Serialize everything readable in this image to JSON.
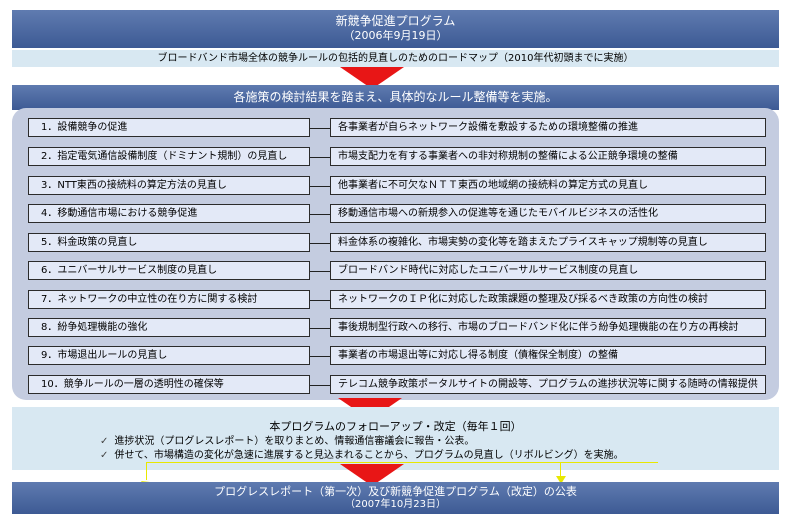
{
  "header": {
    "title": "新競争促進プログラム",
    "date": "（2006年9月19日）",
    "subtitle": "ブロードバンド市場全体の競争ルールの包括的見直しのためのロードマップ（2010年代初頭までに実施）"
  },
  "panel": {
    "heading": "各施策の検討結果を踏まえ、具体的なルール整備等を実施。",
    "items": [
      {
        "left": "1．設備競争の促進",
        "right": "各事業者が自らネットワーク設備を敷設するための環境整備の推進"
      },
      {
        "left": "2．指定電気通信設備制度（ドミナント規制）の見直し",
        "right": "市場支配力を有する事業者への非対称規制の整備による公正競争環境の整備"
      },
      {
        "left": "3．NTT東西の接続料の算定方法の見直し",
        "right": "他事業者に不可欠なＮＴＴ東西の地域網の接続料の算定方式の見直し"
      },
      {
        "left": "4．移動通信市場における競争促進",
        "right": "移動通信市場への新規参入の促進等を通じたモバイルビジネスの活性化"
      },
      {
        "left": "5．料金政策の見直し",
        "right": "料金体系の複雑化、市場実勢の変化等を踏まえたプライスキャップ規制等の見直し"
      },
      {
        "left": "6．ユニバーサルサービス制度の見直し",
        "right": "ブロードバンド時代に対応したユニバーサルサービス制度の見直し"
      },
      {
        "left": "7．ネットワークの中立性の在り方に関する検討",
        "right": "ネットワークのＩＰ化に対応した政策課題の整理及び採るべき政策の方向性の検討"
      },
      {
        "left": "8．紛争処理機能の強化",
        "right": "事後規制型行政への移行、市場のブロードバンド化に伴う紛争処理機能の在り方の再検討"
      },
      {
        "left": "9．市場退出ルールの見直し",
        "right": "事業者の市場退出等に対応し得る制度（債権保全制度）の整備"
      },
      {
        "left": "10．競争ルールの一層の透明性の確保等",
        "right": "テレコム競争政策ポータルサイトの開設等、プログラムの進捗状況等に関する随時の情報提供"
      }
    ]
  },
  "followup": {
    "title": "本プログラムのフォローアップ・改定（毎年１回）",
    "bullet_mark": "✓",
    "bullets": [
      "進捗状況（プログレスレポート）を取りまとめ、情報通信審議会に報告・公表。",
      "併せて、市場構造の変化が急速に進展すると見込まれることから、プログラムの見直し（リボルビング）を実施。"
    ]
  },
  "footer": {
    "title": "プログレスレポート（第一次）及び新競争促進プログラム（改定）の公表",
    "date": "（2007年10月23日）"
  },
  "colors": {
    "dark_bar": "#4a67a0",
    "light_bar": "#d8e8f2",
    "panel": "#c4cce0",
    "item_box": "#e3e9f7",
    "arrow": "#e81616",
    "connector_yellow": "#e8e800"
  }
}
